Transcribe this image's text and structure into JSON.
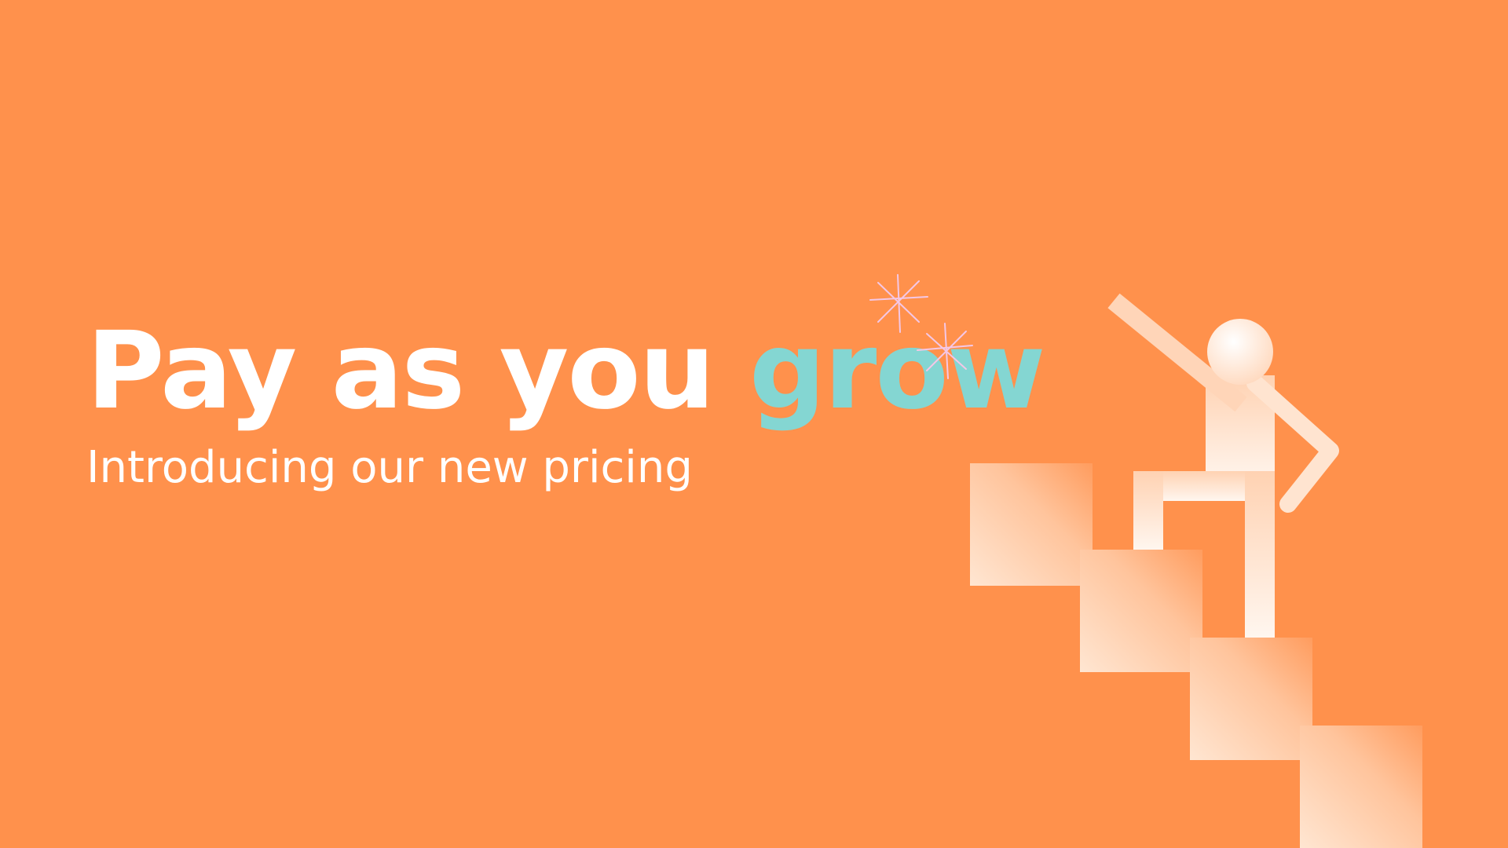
{
  "headline": {
    "part1": "Pay as you",
    "accent": "grow"
  },
  "subheadline": "Introducing our new pricing",
  "colors": {
    "background": "#FF914C",
    "text": "#FFFFFF",
    "accent": "#84D6D2",
    "sparkle": "#F4C7E6"
  },
  "illustration": {
    "figure": "person-climbing-stairs-icon",
    "sparkles": "sparkle-icon"
  }
}
